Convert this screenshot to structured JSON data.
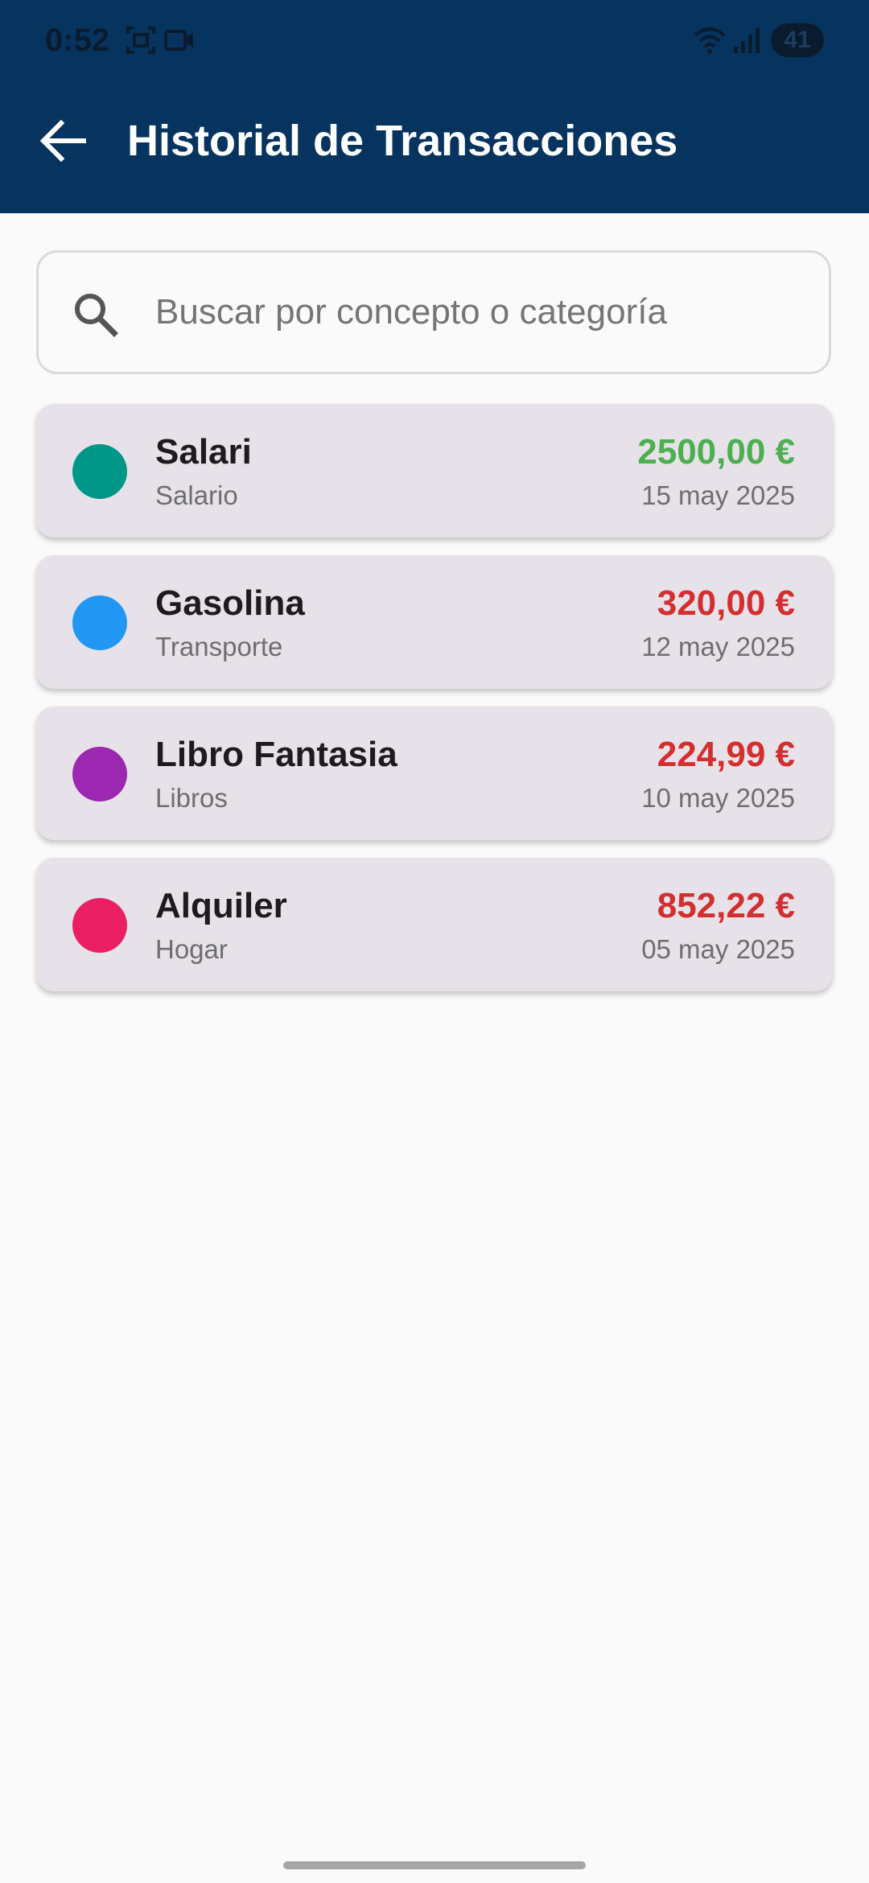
{
  "status_bar": {
    "time": "0:52",
    "battery": "41",
    "icons": [
      "screenshot-icon",
      "video-record-icon",
      "wifi-icon",
      "signal-icon",
      "battery-icon"
    ]
  },
  "header": {
    "title": "Historial de Transacciones",
    "back_icon": "arrow-left-icon",
    "background_color": "#07345f"
  },
  "search": {
    "placeholder": "Buscar por concepto o categoría",
    "value": "",
    "icon": "search-icon"
  },
  "transactions": [
    {
      "concept": "Salari",
      "category": "Salario",
      "amount": "2500,00 €",
      "date": "15 may 2025",
      "dot_color": "#009688",
      "amount_color": "#4caf50"
    },
    {
      "concept": "Gasolina",
      "category": "Transporte",
      "amount": "320,00 €",
      "date": "12 may 2025",
      "dot_color": "#2196f3",
      "amount_color": "#d32f2f"
    },
    {
      "concept": "Libro Fantasia",
      "category": "Libros",
      "amount": "224,99 €",
      "date": "10 may 2025",
      "dot_color": "#9c27b0",
      "amount_color": "#d32f2f"
    },
    {
      "concept": "Alquiler",
      "category": "Hogar",
      "amount": "852,22 €",
      "date": "05 may 2025",
      "dot_color": "#e91e63",
      "amount_color": "#d32f2f"
    }
  ]
}
